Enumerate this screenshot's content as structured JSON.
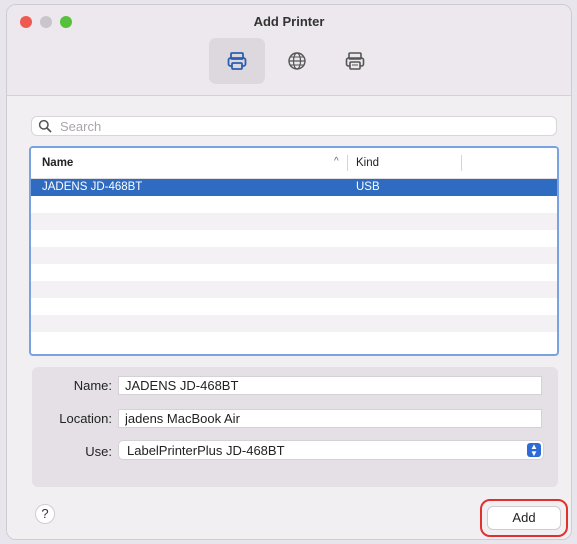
{
  "window": {
    "title": "Add Printer"
  },
  "toolbar": {
    "items": [
      {
        "icon": "printer-icon",
        "selected": true
      },
      {
        "icon": "globe-icon",
        "selected": false
      },
      {
        "icon": "windows-printer-icon",
        "selected": false
      }
    ]
  },
  "search": {
    "placeholder": "Search",
    "value": ""
  },
  "printer_list": {
    "columns": {
      "name": "Name",
      "kind": "Kind"
    },
    "sort": "ascending",
    "rows": [
      {
        "name": "JADENS JD-468BT",
        "kind": "USB",
        "selected": true
      }
    ]
  },
  "details": {
    "name_label": "Name:",
    "name_value": "JADENS JD-468BT",
    "location_label": "Location:",
    "location_value": "jadens MacBook Air",
    "use_label": "Use:",
    "use_value": "LabelPrinterPlus JD-468BT"
  },
  "footer": {
    "help_label": "?",
    "add_label": "Add"
  },
  "colors": {
    "selection": "#2f6bc1",
    "highlight_ring": "#e0312e",
    "accent": "#2f6bd6"
  }
}
